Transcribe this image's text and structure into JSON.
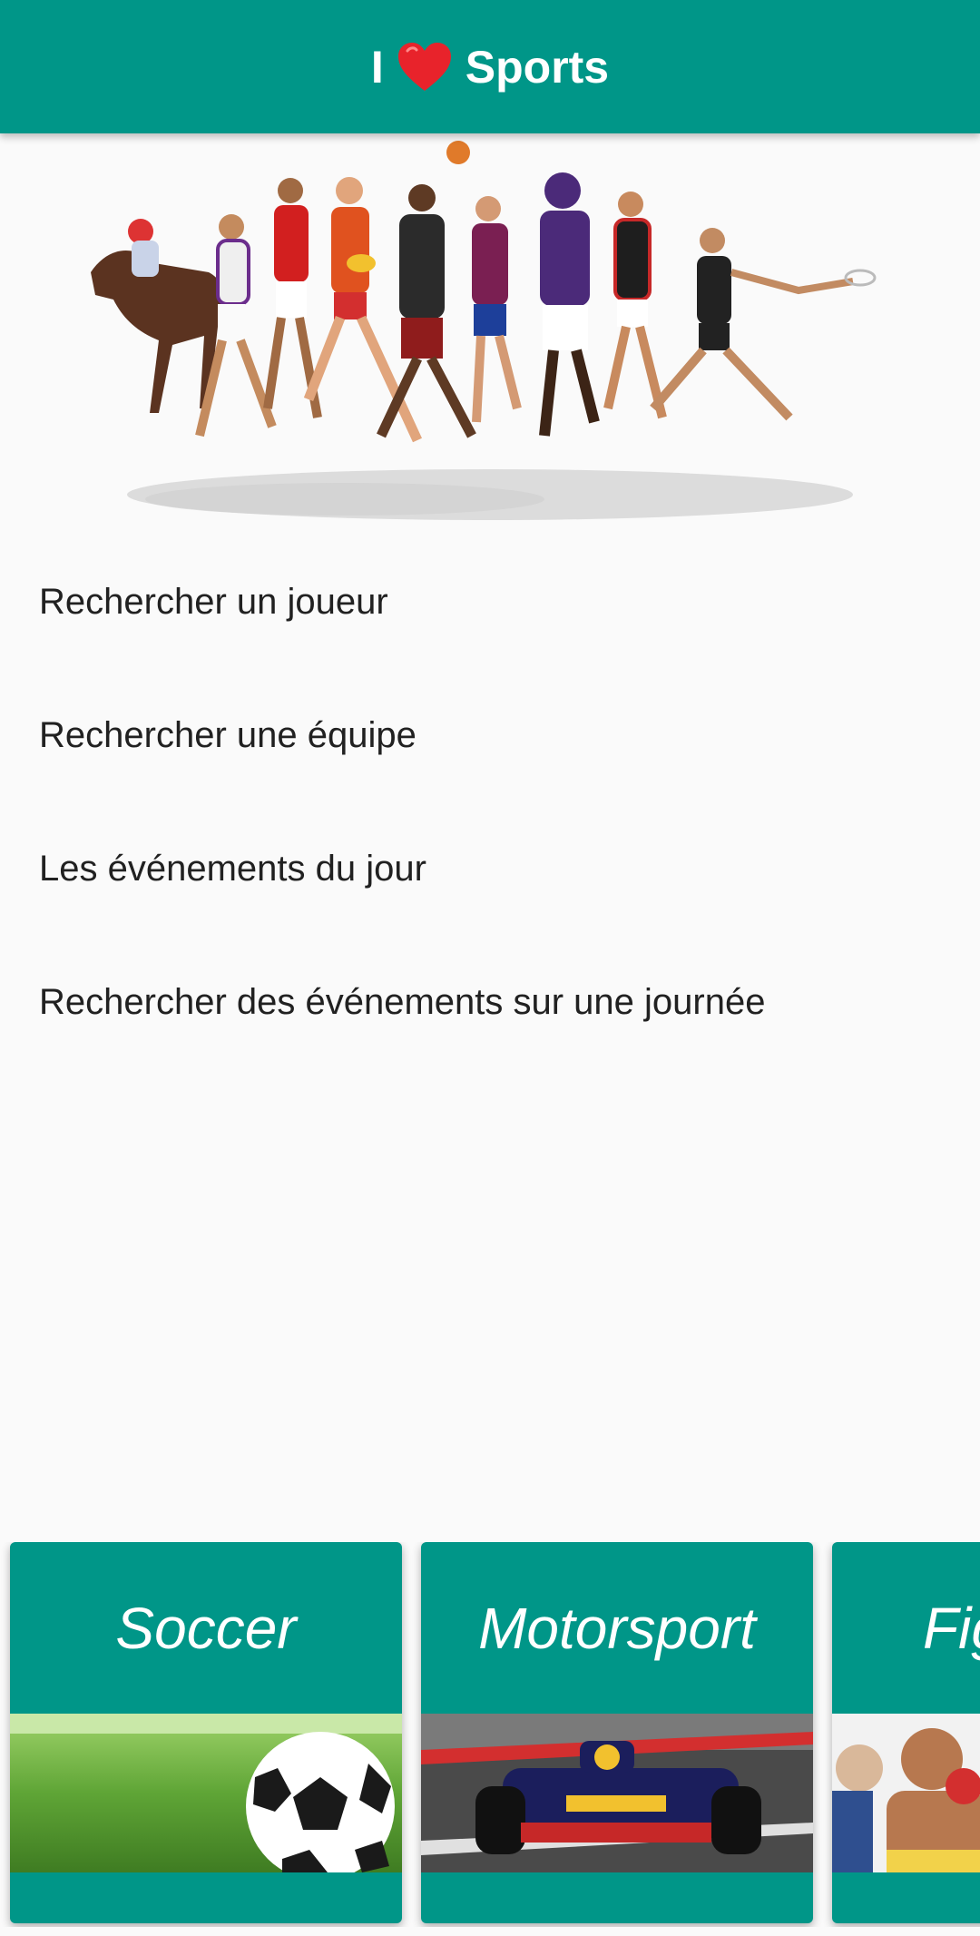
{
  "toolbar": {
    "title_prefix": "I",
    "title_icon": "heart-icon",
    "title_suffix": "Sports",
    "accent_color": "#009688",
    "heart_color": "#e8232b"
  },
  "banner": {
    "image": "athletes-banner-image"
  },
  "menu": {
    "items": [
      {
        "label": "Rechercher un joueur"
      },
      {
        "label": "Rechercher une équipe"
      },
      {
        "label": "Les événements du jour"
      },
      {
        "label": "Rechercher des événements sur une journée"
      }
    ]
  },
  "sports": {
    "cards": [
      {
        "title": "Soccer",
        "image": "soccer-ball-image"
      },
      {
        "title": "Motorsport",
        "image": "formula-one-car-image"
      },
      {
        "title": "Fighting",
        "image": "boxing-image"
      }
    ]
  }
}
